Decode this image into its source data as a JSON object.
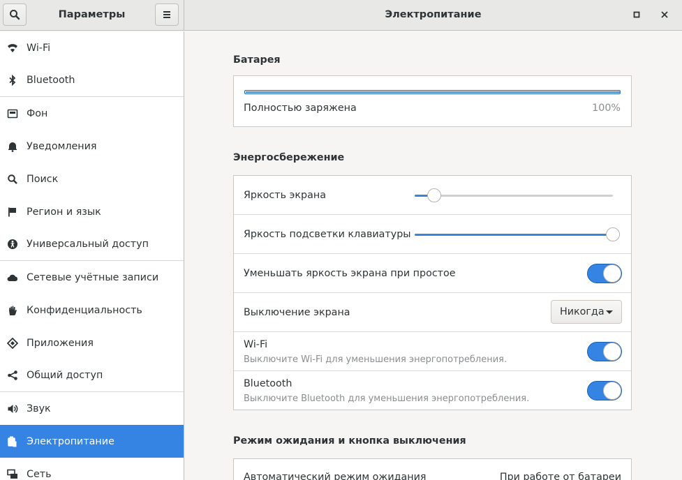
{
  "sidebar_header": {
    "title": "Параметры",
    "search_icon": "search-icon",
    "menu_icon": "hamburger-menu-icon"
  },
  "main_header": {
    "title": "Электропитание"
  },
  "sidebar": {
    "items": [
      {
        "label": "Wi-Fi",
        "icon": "wifi-icon"
      },
      {
        "label": "Bluetooth",
        "icon": "bluetooth-icon"
      },
      {
        "label": "Фон",
        "icon": "background-icon"
      },
      {
        "label": "Уведомления",
        "icon": "bell-icon"
      },
      {
        "label": "Поиск",
        "icon": "search-icon"
      },
      {
        "label": "Регион и язык",
        "icon": "flag-icon"
      },
      {
        "label": "Универсальный доступ",
        "icon": "accessibility-icon"
      },
      {
        "label": "Сетевые учётные записи",
        "icon": "cloud-icon"
      },
      {
        "label": "Конфиденциальность",
        "icon": "hand-icon"
      },
      {
        "label": "Приложения",
        "icon": "apps-icon"
      },
      {
        "label": "Общий доступ",
        "icon": "share-icon"
      },
      {
        "label": "Звук",
        "icon": "speaker-icon"
      },
      {
        "label": "Электропитание",
        "icon": "power-icon",
        "active": true
      },
      {
        "label": "Сеть",
        "icon": "network-icon"
      }
    ]
  },
  "battery": {
    "section_title": "Батарея",
    "status": "Полностью заряжена",
    "percent_text": "100%",
    "level": 1.0
  },
  "power_saving": {
    "section_title": "Энергосбережение",
    "screen_brightness": {
      "label": "Яркость экрана",
      "value": 0.1
    },
    "keyboard_brightness": {
      "label": "Яркость подсветки клавиатуры",
      "value": 1.0
    },
    "dim_screen": {
      "label": "Уменьшать яркость экрана при простое",
      "on": true
    },
    "blank_screen": {
      "label": "Выключение экрана",
      "value": "Никогда"
    },
    "wifi": {
      "label": "Wi-Fi",
      "sub": "Выключите Wi-Fi для уменьшения энергопотребления.",
      "on": true
    },
    "bluetooth": {
      "label": "Bluetooth",
      "sub": "Выключите Bluetooth для уменьшения энергопотребления.",
      "on": true
    }
  },
  "suspend": {
    "section_title": "Режим ожидания и кнопка выключения",
    "auto_suspend_label": "Автоматический режим ожидания",
    "auto_suspend_value": "При работе от батареи"
  },
  "colors": {
    "accent": "#3584e4",
    "sidebar_bg": "#ffffff",
    "content_bg": "#f6f5f4"
  }
}
